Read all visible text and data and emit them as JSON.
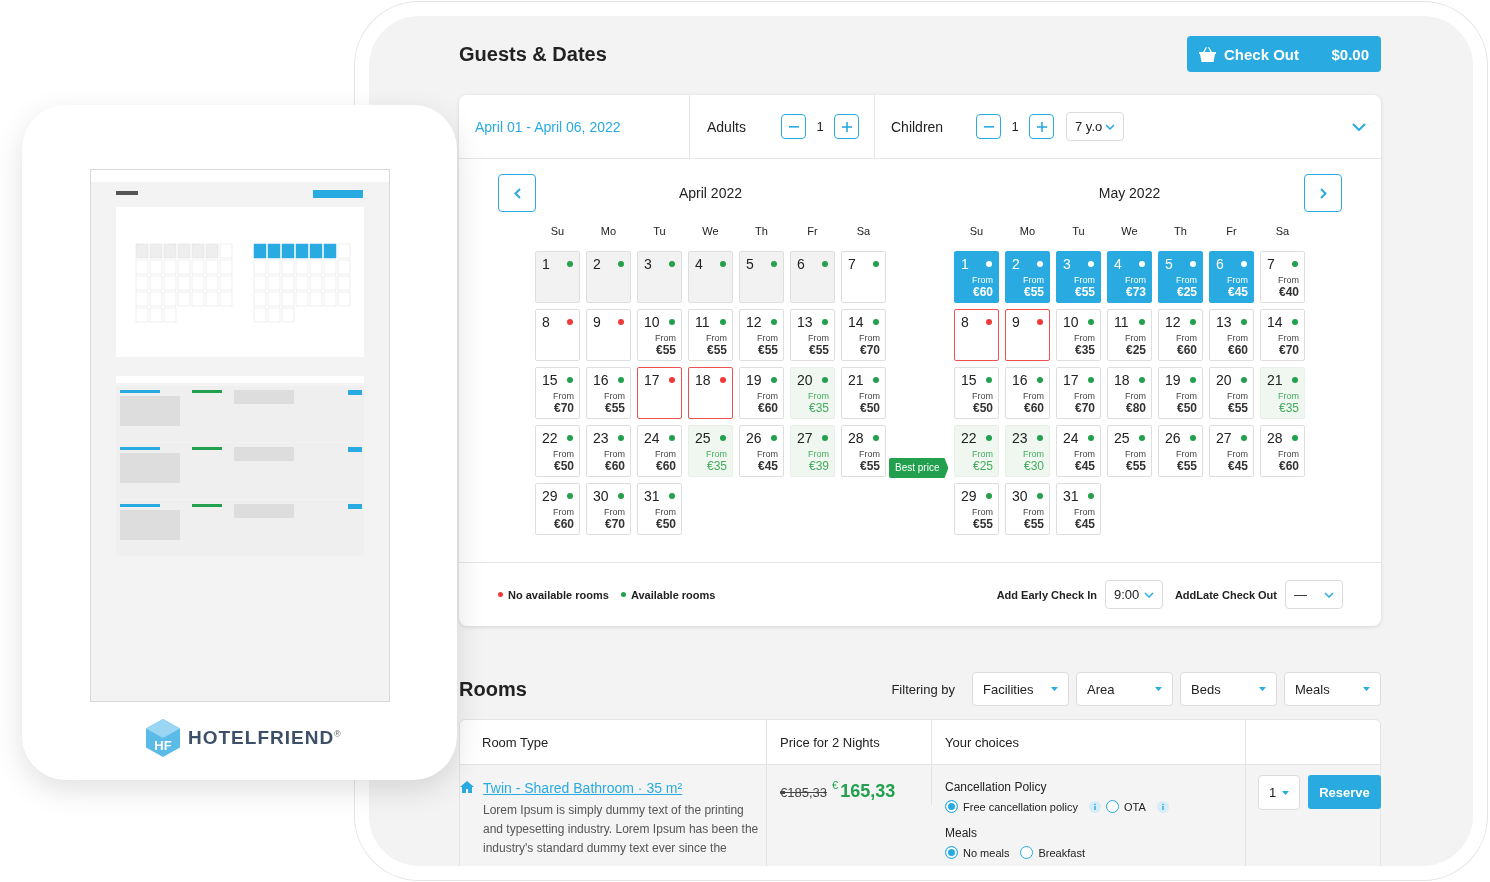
{
  "showcase": {
    "logo": {
      "mark": "HF",
      "name": "HOTELFRIEND",
      "registered": "®"
    }
  },
  "page": {
    "title": "Guests & Dates",
    "checkout": {
      "label": "Check Out",
      "total": "$0.00"
    }
  },
  "search": {
    "date_range": "April 01 - April 06, 2022",
    "adults": {
      "label": "Adults",
      "count": "1"
    },
    "children": {
      "label": "Children",
      "count": "1",
      "age": "7 y.o"
    }
  },
  "calendar": {
    "best_price_tag": "Best price",
    "months": [
      {
        "title": "April 2022",
        "weekdays": [
          "Su",
          "Mo",
          "Tu",
          "We",
          "Th",
          "Fr",
          "Sa"
        ],
        "days": [
          {
            "day": "1",
            "kind": "past",
            "available": true
          },
          {
            "day": "2",
            "kind": "past",
            "available": true
          },
          {
            "day": "3",
            "kind": "past",
            "available": true
          },
          {
            "day": "4",
            "kind": "past",
            "available": true
          },
          {
            "day": "5",
            "kind": "past",
            "available": true
          },
          {
            "day": "6",
            "kind": "past",
            "available": true
          },
          {
            "day": "7",
            "kind": "open",
            "available": true
          },
          {
            "day": "8",
            "kind": "open",
            "available": false
          },
          {
            "day": "9",
            "kind": "open",
            "available": false
          },
          {
            "day": "10",
            "kind": "open",
            "available": true,
            "from": "From",
            "price": "€55"
          },
          {
            "day": "11",
            "kind": "open",
            "available": true,
            "from": "From",
            "price": "€55"
          },
          {
            "day": "12",
            "kind": "open",
            "available": true,
            "from": "From",
            "price": "€55"
          },
          {
            "day": "13",
            "kind": "open",
            "available": true,
            "from": "From",
            "price": "€55"
          },
          {
            "day": "14",
            "kind": "open",
            "available": true,
            "from": "From",
            "price": "€70"
          },
          {
            "day": "15",
            "kind": "open",
            "available": true,
            "from": "From",
            "price": "€70"
          },
          {
            "day": "16",
            "kind": "open",
            "available": true,
            "from": "From",
            "price": "€55"
          },
          {
            "day": "17",
            "kind": "blocked",
            "available": false
          },
          {
            "day": "18",
            "kind": "blocked",
            "available": false
          },
          {
            "day": "19",
            "kind": "open",
            "available": true,
            "from": "From",
            "price": "€60"
          },
          {
            "day": "20",
            "kind": "best",
            "available": true,
            "from": "From",
            "price": "€35"
          },
          {
            "day": "21",
            "kind": "open",
            "available": true,
            "from": "From",
            "price": "€50"
          },
          {
            "day": "22",
            "kind": "open",
            "available": true,
            "from": "From",
            "price": "€50"
          },
          {
            "day": "23",
            "kind": "open",
            "available": true,
            "from": "From",
            "price": "€60"
          },
          {
            "day": "24",
            "kind": "open",
            "available": true,
            "from": "From",
            "price": "€60"
          },
          {
            "day": "25",
            "kind": "best",
            "available": true,
            "from": "From",
            "price": "€35"
          },
          {
            "day": "26",
            "kind": "open",
            "available": true,
            "from": "From",
            "price": "€45"
          },
          {
            "day": "27",
            "kind": "best",
            "available": true,
            "from": "From",
            "price": "€39"
          },
          {
            "day": "28",
            "kind": "open",
            "available": true,
            "from": "From",
            "price": "€55"
          },
          {
            "day": "29",
            "kind": "open",
            "available": true,
            "from": "From",
            "price": "€60"
          },
          {
            "day": "30",
            "kind": "open",
            "available": true,
            "from": "From",
            "price": "€70"
          },
          {
            "day": "31",
            "kind": "open",
            "available": true,
            "from": "From",
            "price": "€50"
          }
        ]
      },
      {
        "title": "May 2022",
        "weekdays": [
          "Su",
          "Mo",
          "Tu",
          "We",
          "Th",
          "Fr",
          "Sa"
        ],
        "days": [
          {
            "day": "1",
            "kind": "selected",
            "from": "From",
            "price": "€60"
          },
          {
            "day": "2",
            "kind": "selected",
            "from": "From",
            "price": "€55"
          },
          {
            "day": "3",
            "kind": "selected",
            "from": "From",
            "price": "€55"
          },
          {
            "day": "4",
            "kind": "selected",
            "from": "From",
            "price": "€73"
          },
          {
            "day": "5",
            "kind": "selected",
            "from": "From",
            "price": "€25"
          },
          {
            "day": "6",
            "kind": "selected",
            "from": "From",
            "price": "€45"
          },
          {
            "day": "7",
            "kind": "open",
            "available": true,
            "from": "From",
            "price": "€40"
          },
          {
            "day": "8",
            "kind": "blocked",
            "available": false
          },
          {
            "day": "9",
            "kind": "blocked",
            "available": false
          },
          {
            "day": "10",
            "kind": "open",
            "available": true,
            "from": "From",
            "price": "€35"
          },
          {
            "day": "11",
            "kind": "open",
            "available": true,
            "from": "From",
            "price": "€25"
          },
          {
            "day": "12",
            "kind": "open",
            "available": true,
            "from": "From",
            "price": "€60"
          },
          {
            "day": "13",
            "kind": "open",
            "available": true,
            "from": "From",
            "price": "€60"
          },
          {
            "day": "14",
            "kind": "open",
            "available": true,
            "from": "From",
            "price": "€70"
          },
          {
            "day": "15",
            "kind": "open",
            "available": true,
            "from": "From",
            "price": "€50"
          },
          {
            "day": "16",
            "kind": "open",
            "available": true,
            "from": "From",
            "price": "€60"
          },
          {
            "day": "17",
            "kind": "open",
            "available": true,
            "from": "From",
            "price": "€70"
          },
          {
            "day": "18",
            "kind": "open",
            "available": true,
            "from": "From",
            "price": "€80"
          },
          {
            "day": "19",
            "kind": "open",
            "available": true,
            "from": "From",
            "price": "€50"
          },
          {
            "day": "20",
            "kind": "open",
            "available": true,
            "from": "From",
            "price": "€55"
          },
          {
            "day": "21",
            "kind": "best",
            "available": true,
            "from": "From",
            "price": "€35"
          },
          {
            "day": "22",
            "kind": "best",
            "available": true,
            "from": "From",
            "price": "€25"
          },
          {
            "day": "23",
            "kind": "best",
            "available": true,
            "from": "From",
            "price": "€30"
          },
          {
            "day": "24",
            "kind": "open",
            "available": true,
            "from": "From",
            "price": "€45"
          },
          {
            "day": "25",
            "kind": "open",
            "available": true,
            "from": "From",
            "price": "€55"
          },
          {
            "day": "26",
            "kind": "open",
            "available": true,
            "from": "From",
            "price": "€55"
          },
          {
            "day": "27",
            "kind": "open",
            "available": true,
            "from": "From",
            "price": "€45"
          },
          {
            "day": "28",
            "kind": "open",
            "available": true,
            "from": "From",
            "price": "€60"
          },
          {
            "day": "29",
            "kind": "open",
            "available": true,
            "from": "From",
            "price": "€55"
          },
          {
            "day": "30",
            "kind": "open",
            "available": true,
            "from": "From",
            "price": "€55"
          },
          {
            "day": "31",
            "kind": "open",
            "available": true,
            "from": "From",
            "price": "€45"
          }
        ]
      }
    ]
  },
  "legend": [
    {
      "label": "No available rooms",
      "color": "#f03a3a"
    },
    {
      "label": "Available rooms",
      "color": "#23a04e"
    }
  ],
  "extras": [
    {
      "label": "Add Early Check In",
      "value": "9:00"
    },
    {
      "label": "AddLate Check Out",
      "value": "—"
    }
  ],
  "rooms": {
    "title": "Rooms",
    "filter_label": "Filtering by",
    "filters": [
      "Facilities",
      "Area",
      "Beds",
      "Meals"
    ],
    "columns": [
      "Room Type",
      "Price for 2 Nights",
      "Your choices"
    ],
    "rows": [
      {
        "name": "Twin - Shared Bathroom · 35 m²",
        "description": "Lorem Ipsum is simply dummy text of the printing\nand typesetting industry. Lorem Ipsum has been the\nindustry's standard dummy text ever since the",
        "old_price": "€185,33",
        "currency": "€",
        "price": "165,33",
        "groups": [
          {
            "title": "Cancellation Policy",
            "options": [
              {
                "label": "Free cancellation policy",
                "selected": true,
                "info": true
              },
              {
                "label": "OTA",
                "selected": false,
                "info": true
              }
            ]
          },
          {
            "title": "Meals",
            "options": [
              {
                "label": "No meals",
                "selected": true
              },
              {
                "label": "Breakfast",
                "selected": false
              }
            ]
          }
        ],
        "quantity": "1",
        "action": "Reserve"
      }
    ]
  }
}
